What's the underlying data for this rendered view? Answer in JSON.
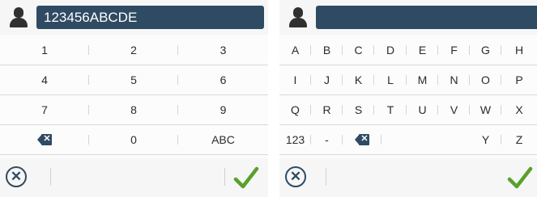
{
  "numeric_keyboard": {
    "field_value": "123456ABCDE",
    "rows": [
      [
        "1",
        "2",
        "3"
      ],
      [
        "4",
        "5",
        "6"
      ],
      [
        "7",
        "8",
        "9"
      ],
      [
        "⌫",
        "0",
        "ABC"
      ]
    ],
    "backspace_label": "✕"
  },
  "alpha_keyboard": {
    "field_value": "",
    "rows": [
      [
        "A",
        "B",
        "C",
        "D",
        "E",
        "F",
        "G",
        "H"
      ],
      [
        "I",
        "J",
        "K",
        "L",
        "M",
        "N",
        "O",
        "P"
      ],
      [
        "Q",
        "R",
        "S",
        "T",
        "U",
        "V",
        "W",
        "X"
      ],
      [
        "123",
        "-",
        "⌫",
        "",
        "",
        "",
        "Y",
        "Z"
      ]
    ],
    "backspace_label": "✕"
  },
  "footer": {
    "cancel_label": "✕"
  },
  "colors": {
    "field_bg": "#2f4b63",
    "confirm_check": "#58a12a"
  },
  "icons": [
    "user-icon",
    "backspace-icon",
    "cancel-icon",
    "checkmark-icon"
  ]
}
